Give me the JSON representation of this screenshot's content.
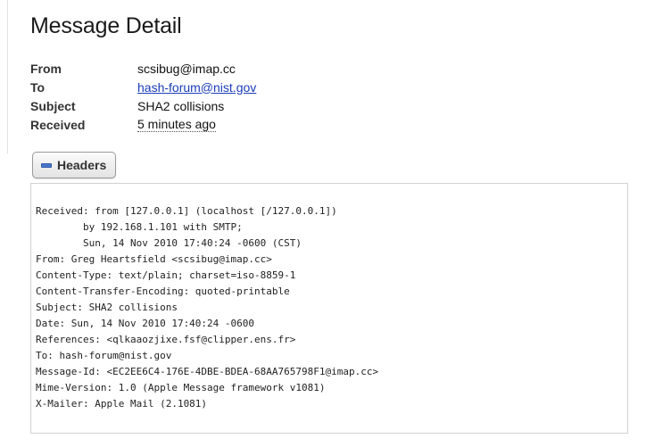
{
  "page": {
    "title": "Message Detail"
  },
  "meta": {
    "from_label": "From",
    "from_value": "scsibug@imap.cc",
    "to_label": "To",
    "to_value": "hash-forum@nist.gov",
    "subject_label": "Subject",
    "subject_value": "SHA2 collisions",
    "received_label": "Received",
    "received_value": "5 minutes ago"
  },
  "headers_toggle": {
    "label": "Headers",
    "icon": "minus-icon"
  },
  "raw_headers": [
    "Received: from [127.0.0.1] (localhost [/127.0.0.1])",
    "        by 192.168.1.101 with SMTP;",
    "        Sun, 14 Nov 2010 17:40:24 -0600 (CST)",
    "From: Greg Heartsfield <scsibug@imap.cc>",
    "Content-Type: text/plain; charset=iso-8859-1",
    "Content-Transfer-Encoding: quoted-printable",
    "Subject: SHA2 collisions",
    "Date: Sun, 14 Nov 2010 17:40:24 -0600",
    "References: <qlkaaozjixe.fsf@clipper.ens.fr>",
    "To: hash-forum@nist.gov",
    "Message-Id: <EC2EE6C4-176E-4DBE-BDEA-68AA765798F1@imap.cc>",
    "Mime-Version: 1.0 (Apple Message framework v1081)",
    "X-Mailer: Apple Mail (2.1081)"
  ],
  "colors": {
    "link": "#1a3db8",
    "toggle_icon": "#4a76c9"
  }
}
